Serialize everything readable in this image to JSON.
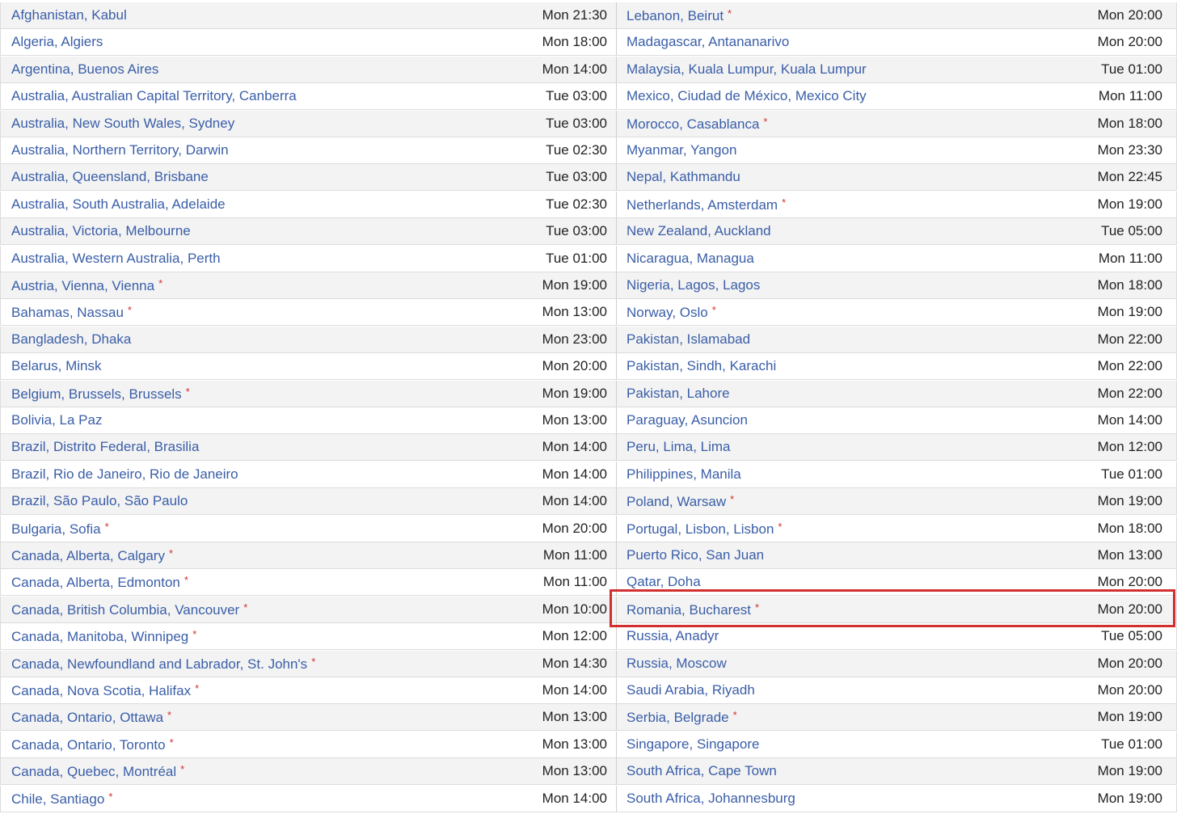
{
  "highlight_color": "#d0302f",
  "rows": [
    {
      "left": {
        "city": "Afghanistan, Kabul",
        "dst": false,
        "time": "Mon 21:30"
      },
      "right": {
        "city": "Lebanon, Beirut",
        "dst": true,
        "time": "Mon 20:00"
      }
    },
    {
      "left": {
        "city": "Algeria, Algiers",
        "dst": false,
        "time": "Mon 18:00"
      },
      "right": {
        "city": "Madagascar, Antananarivo",
        "dst": false,
        "time": "Mon 20:00"
      }
    },
    {
      "left": {
        "city": "Argentina, Buenos Aires",
        "dst": false,
        "time": "Mon 14:00"
      },
      "right": {
        "city": "Malaysia, Kuala Lumpur, Kuala Lumpur",
        "dst": false,
        "time": "Tue 01:00"
      }
    },
    {
      "left": {
        "city": "Australia, Australian Capital Territory, Canberra",
        "dst": false,
        "time": "Tue 03:00"
      },
      "right": {
        "city": "Mexico, Ciudad de México, Mexico City",
        "dst": false,
        "time": "Mon 11:00"
      }
    },
    {
      "left": {
        "city": "Australia, New South Wales, Sydney",
        "dst": false,
        "time": "Tue 03:00"
      },
      "right": {
        "city": "Morocco, Casablanca",
        "dst": true,
        "time": "Mon 18:00"
      }
    },
    {
      "left": {
        "city": "Australia, Northern Territory, Darwin",
        "dst": false,
        "time": "Tue 02:30"
      },
      "right": {
        "city": "Myanmar, Yangon",
        "dst": false,
        "time": "Mon 23:30"
      }
    },
    {
      "left": {
        "city": "Australia, Queensland, Brisbane",
        "dst": false,
        "time": "Tue 03:00"
      },
      "right": {
        "city": "Nepal, Kathmandu",
        "dst": false,
        "time": "Mon 22:45"
      }
    },
    {
      "left": {
        "city": "Australia, South Australia, Adelaide",
        "dst": false,
        "time": "Tue 02:30"
      },
      "right": {
        "city": "Netherlands, Amsterdam",
        "dst": true,
        "time": "Mon 19:00"
      }
    },
    {
      "left": {
        "city": "Australia, Victoria, Melbourne",
        "dst": false,
        "time": "Tue 03:00"
      },
      "right": {
        "city": "New Zealand, Auckland",
        "dst": false,
        "time": "Tue 05:00"
      }
    },
    {
      "left": {
        "city": "Australia, Western Australia, Perth",
        "dst": false,
        "time": "Tue 01:00"
      },
      "right": {
        "city": "Nicaragua, Managua",
        "dst": false,
        "time": "Mon 11:00"
      }
    },
    {
      "left": {
        "city": "Austria, Vienna, Vienna",
        "dst": true,
        "time": "Mon 19:00"
      },
      "right": {
        "city": "Nigeria, Lagos, Lagos",
        "dst": false,
        "time": "Mon 18:00"
      }
    },
    {
      "left": {
        "city": "Bahamas, Nassau",
        "dst": true,
        "time": "Mon 13:00"
      },
      "right": {
        "city": "Norway, Oslo",
        "dst": true,
        "time": "Mon 19:00"
      }
    },
    {
      "left": {
        "city": "Bangladesh, Dhaka",
        "dst": false,
        "time": "Mon 23:00"
      },
      "right": {
        "city": "Pakistan, Islamabad",
        "dst": false,
        "time": "Mon 22:00"
      }
    },
    {
      "left": {
        "city": "Belarus, Minsk",
        "dst": false,
        "time": "Mon 20:00"
      },
      "right": {
        "city": "Pakistan, Sindh, Karachi",
        "dst": false,
        "time": "Mon 22:00"
      }
    },
    {
      "left": {
        "city": "Belgium, Brussels, Brussels",
        "dst": true,
        "time": "Mon 19:00"
      },
      "right": {
        "city": "Pakistan, Lahore",
        "dst": false,
        "time": "Mon 22:00"
      }
    },
    {
      "left": {
        "city": "Bolivia, La Paz",
        "dst": false,
        "time": "Mon 13:00"
      },
      "right": {
        "city": "Paraguay, Asuncion",
        "dst": false,
        "time": "Mon 14:00"
      }
    },
    {
      "left": {
        "city": "Brazil, Distrito Federal, Brasilia",
        "dst": false,
        "time": "Mon 14:00"
      },
      "right": {
        "city": "Peru, Lima, Lima",
        "dst": false,
        "time": "Mon 12:00"
      }
    },
    {
      "left": {
        "city": "Brazil, Rio de Janeiro, Rio de Janeiro",
        "dst": false,
        "time": "Mon 14:00"
      },
      "right": {
        "city": "Philippines, Manila",
        "dst": false,
        "time": "Tue 01:00"
      }
    },
    {
      "left": {
        "city": "Brazil, São Paulo, São Paulo",
        "dst": false,
        "time": "Mon 14:00"
      },
      "right": {
        "city": "Poland, Warsaw",
        "dst": true,
        "time": "Mon 19:00"
      }
    },
    {
      "left": {
        "city": "Bulgaria, Sofia",
        "dst": true,
        "time": "Mon 20:00"
      },
      "right": {
        "city": "Portugal, Lisbon, Lisbon",
        "dst": true,
        "time": "Mon 18:00"
      }
    },
    {
      "left": {
        "city": "Canada, Alberta, Calgary",
        "dst": true,
        "time": "Mon 11:00"
      },
      "right": {
        "city": "Puerto Rico, San Juan",
        "dst": false,
        "time": "Mon 13:00"
      }
    },
    {
      "left": {
        "city": "Canada, Alberta, Edmonton",
        "dst": true,
        "time": "Mon 11:00"
      },
      "right": {
        "city": "Qatar, Doha",
        "dst": false,
        "time": "Mon 20:00"
      }
    },
    {
      "left": {
        "city": "Canada, British Columbia, Vancouver",
        "dst": true,
        "time": "Mon 10:00"
      },
      "right": {
        "city": "Romania, Bucharest",
        "dst": true,
        "time": "Mon 20:00"
      }
    },
    {
      "left": {
        "city": "Canada, Manitoba, Winnipeg",
        "dst": true,
        "time": "Mon 12:00"
      },
      "right": {
        "city": "Russia, Anadyr",
        "dst": false,
        "time": "Tue 05:00"
      }
    },
    {
      "left": {
        "city": "Canada, Newfoundland and Labrador, St. John's",
        "dst": true,
        "time": "Mon 14:30"
      },
      "right": {
        "city": "Russia, Moscow",
        "dst": false,
        "time": "Mon 20:00"
      }
    },
    {
      "left": {
        "city": "Canada, Nova Scotia, Halifax",
        "dst": true,
        "time": "Mon 14:00"
      },
      "right": {
        "city": "Saudi Arabia, Riyadh",
        "dst": false,
        "time": "Mon 20:00"
      }
    },
    {
      "left": {
        "city": "Canada, Ontario, Ottawa",
        "dst": true,
        "time": "Mon 13:00"
      },
      "right": {
        "city": "Serbia, Belgrade",
        "dst": true,
        "time": "Mon 19:00"
      }
    },
    {
      "left": {
        "city": "Canada, Ontario, Toronto",
        "dst": true,
        "time": "Mon 13:00"
      },
      "right": {
        "city": "Singapore, Singapore",
        "dst": false,
        "time": "Tue 01:00"
      }
    },
    {
      "left": {
        "city": "Canada, Quebec, Montréal",
        "dst": true,
        "time": "Mon 13:00"
      },
      "right": {
        "city": "South Africa, Cape Town",
        "dst": false,
        "time": "Mon 19:00"
      }
    },
    {
      "left": {
        "city": "Chile, Santiago",
        "dst": true,
        "time": "Mon 14:00"
      },
      "right": {
        "city": "South Africa, Johannesburg",
        "dst": false,
        "time": "Mon 19:00"
      }
    }
  ]
}
